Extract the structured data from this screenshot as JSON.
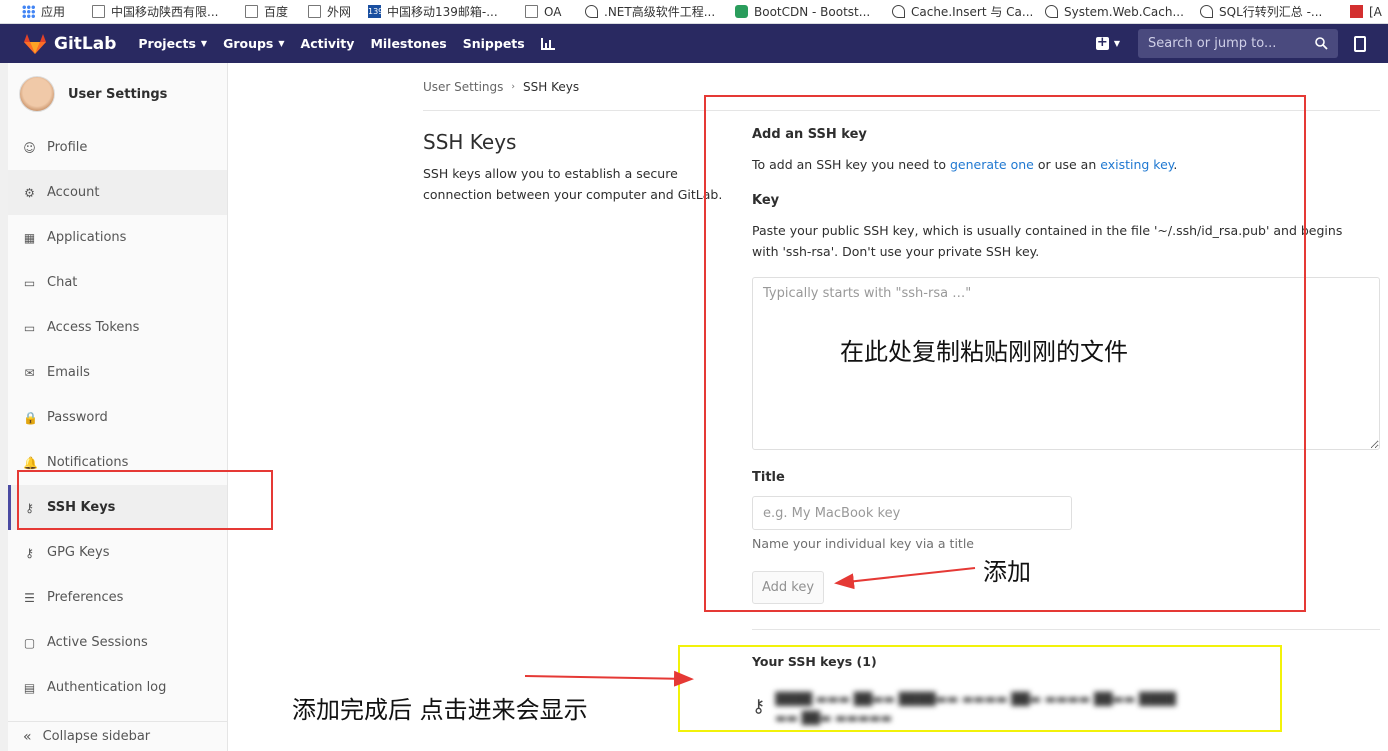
{
  "bookmarks": [
    {
      "icon": "apps-grid-icon",
      "label": "应用"
    },
    {
      "icon": "page-icon",
      "label": "中国移动陕西有限..."
    },
    {
      "icon": "page-icon",
      "label": "百度"
    },
    {
      "icon": "page-icon",
      "label": "外网"
    },
    {
      "icon": "mail139-icon",
      "label": "中国移动139邮箱-..."
    },
    {
      "icon": "page-icon",
      "label": "OA"
    },
    {
      "icon": "cnblogs-icon",
      "label": ".NET高级软件工程..."
    },
    {
      "icon": "bootcdn-icon",
      "label": "BootCDN - Bootst..."
    },
    {
      "icon": "cnblogs-icon",
      "label": "Cache.Insert 与 Ca..."
    },
    {
      "icon": "cnblogs-icon",
      "label": "System.Web.Cach..."
    },
    {
      "icon": "cnblogs-icon",
      "label": "SQL行转列汇总 -..."
    },
    {
      "icon": "csdn-icon",
      "label": "[A"
    }
  ],
  "navbar": {
    "brand": "GitLab",
    "links": [
      {
        "label": "Projects",
        "dropdown": true
      },
      {
        "label": "Groups",
        "dropdown": true
      },
      {
        "label": "Activity",
        "dropdown": false
      },
      {
        "label": "Milestones",
        "dropdown": false
      },
      {
        "label": "Snippets",
        "dropdown": false
      }
    ],
    "search_placeholder": "Search or jump to..."
  },
  "sidebar": {
    "title": "User Settings",
    "items": [
      {
        "label": "Profile",
        "icon": "profile-icon",
        "glyph": "☺"
      },
      {
        "label": "Account",
        "icon": "account-icon",
        "glyph": "⚙"
      },
      {
        "label": "Applications",
        "icon": "applications-icon",
        "glyph": "▦"
      },
      {
        "label": "Chat",
        "icon": "chat-icon",
        "glyph": "▭"
      },
      {
        "label": "Access Tokens",
        "icon": "access-tokens-icon",
        "glyph": "▭"
      },
      {
        "label": "Emails",
        "icon": "emails-icon",
        "glyph": "✉"
      },
      {
        "label": "Password",
        "icon": "lock-icon",
        "glyph": "🔒"
      },
      {
        "label": "Notifications",
        "icon": "bell-icon",
        "glyph": "🔔"
      },
      {
        "label": "SSH Keys",
        "icon": "key-icon",
        "glyph": "⚷"
      },
      {
        "label": "GPG Keys",
        "icon": "key-icon",
        "glyph": "⚷"
      },
      {
        "label": "Preferences",
        "icon": "sliders-icon",
        "glyph": "☰"
      },
      {
        "label": "Active Sessions",
        "icon": "sessions-icon",
        "glyph": "▢"
      },
      {
        "label": "Authentication log",
        "icon": "log-icon",
        "glyph": "▤"
      }
    ],
    "collapse_label": "Collapse sidebar"
  },
  "breadcrumb": {
    "root": "User Settings",
    "current": "SSH Keys"
  },
  "page": {
    "title": "SSH Keys",
    "description": "SSH keys allow you to establish a secure connection between your computer and GitLab."
  },
  "form": {
    "heading": "Add an SSH key",
    "intro_prefix": "To add an SSH key you need to ",
    "intro_link1": "generate one",
    "intro_middle": " or use an ",
    "intro_link2": "existing key",
    "intro_suffix": ".",
    "key_label": "Key",
    "key_help": "Paste your public SSH key, which is usually contained in the file '~/.ssh/id_rsa.pub' and begins with 'ssh-rsa'. Don't use your private SSH key.",
    "key_placeholder": "Typically starts with \"ssh-rsa …\"",
    "title_label": "Title",
    "title_placeholder": "e.g. My MacBook key",
    "title_help": "Name your individual key via a title",
    "submit_label": "Add key"
  },
  "keys_list": {
    "heading": "Your SSH keys (1)"
  },
  "annotations": {
    "paste_here": "在此处复制粘贴刚刚的文件",
    "add": "添加",
    "after_add": "添加完成后  点击进来会显示"
  },
  "colors": {
    "navbar_bg": "#292961",
    "link": "#1f78d1",
    "annotation_red": "#e53935",
    "annotation_yellow": "#f2f20a"
  }
}
